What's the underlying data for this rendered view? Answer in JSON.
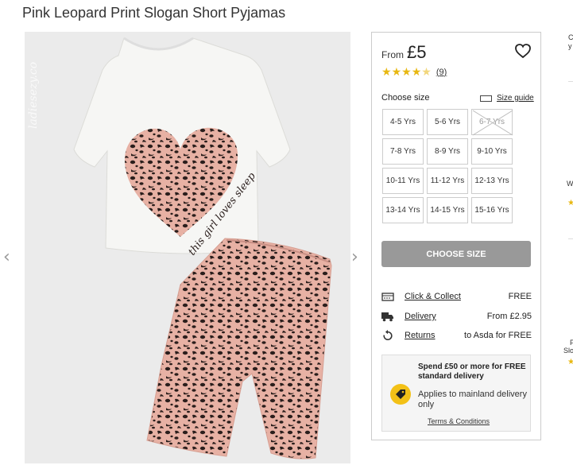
{
  "product": {
    "title": "Pink Leopard Print Slogan Short Pyjamas",
    "image_alt": "Pink leopard print slogan short pyjamas"
  },
  "gallery": {
    "prev_arrow": "‹",
    "next_arrow": "›",
    "slogan": "this girl loves sleep",
    "watermark": "ladiesezy.co"
  },
  "price": {
    "from_label": "From",
    "value": "£5"
  },
  "rating": {
    "stars": 4.5,
    "count": "9"
  },
  "size_selector": {
    "label": "Choose size",
    "guide_label": "Size guide",
    "sizes": [
      {
        "label": "4-5 Yrs",
        "available": true
      },
      {
        "label": "5-6 Yrs",
        "available": true
      },
      {
        "label": "6-7 Yrs",
        "available": false
      },
      {
        "label": "7-8 Yrs",
        "available": true
      },
      {
        "label": "8-9 Yrs",
        "available": true
      },
      {
        "label": "9-10 Yrs",
        "available": true
      },
      {
        "label": "10-11 Yrs",
        "available": true
      },
      {
        "label": "11-12 Yrs",
        "available": true
      },
      {
        "label": "12-13 Yrs",
        "available": true
      },
      {
        "label": "13-14 Yrs",
        "available": true
      },
      {
        "label": "14-15 Yrs",
        "available": true
      },
      {
        "label": "15-16 Yrs",
        "available": true
      }
    ],
    "cta_label": "CHOOSE SIZE"
  },
  "shipping": [
    {
      "icon": "store-icon",
      "label": "Click & Collect",
      "value": "FREE"
    },
    {
      "icon": "truck-icon",
      "label": "Delivery",
      "value": "From £2.95"
    },
    {
      "icon": "return-icon",
      "label": "Returns",
      "value": "to Asda for FREE"
    }
  ],
  "promo": {
    "headline": "Spend £50 or more for FREE standard delivery",
    "subtext": "Applies to mainland delivery only",
    "terms_label": "Terms & Conditions",
    "icon": "tag-icon"
  },
  "recommendations_partial": {
    "top_text_1": "C",
    "top_text_2": "y",
    "item1_text": "W",
    "item2_text_1": "P",
    "item2_text_2": "Slo"
  },
  "colors": {
    "accent_star": "#e8b813",
    "cta_bg": "#999999",
    "promo_tag": "#f3c117",
    "leopard_pink": "#e7b1a4",
    "leopard_spot": "#2a1e1c"
  }
}
